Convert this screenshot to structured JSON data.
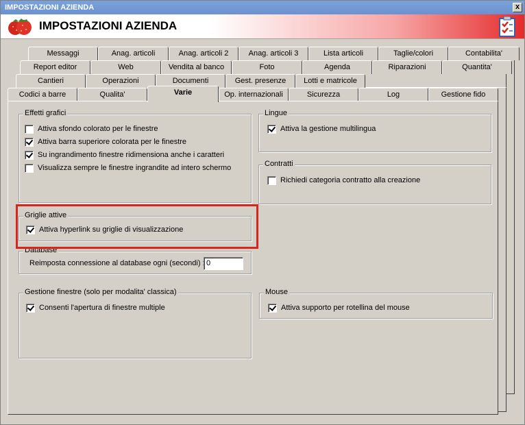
{
  "window": {
    "title": "IMPOSTAZIONI AZIENDA",
    "close_label": "x"
  },
  "header": {
    "title": "IMPOSTAZIONI AZIENDA",
    "logo_icon": "strawberries-icon",
    "right_icon": "checklist-icon"
  },
  "tabs": {
    "row1": [
      "Messaggi",
      "Anag. articoli",
      "Anag. articoli 2",
      "Anag. articoli 3",
      "Lista articoli",
      "Taglie/colori",
      "Contabilita'"
    ],
    "row2": [
      "Report editor",
      "Web",
      "Vendita al banco",
      "Foto",
      "Agenda",
      "Riparazioni",
      "Quantita'"
    ],
    "row3": [
      "Cantieri",
      "Operazioni",
      "Documenti",
      "Gest. presenze",
      "Lotti e matricole"
    ],
    "row4": [
      "Codici a barre",
      "Qualita'",
      "Varie",
      "Op. internazionali",
      "Sicurezza",
      "Log",
      "Gestione fido"
    ],
    "active": "Varie"
  },
  "effetti": {
    "label": "Effetti grafici",
    "items": [
      {
        "label": "Attiva sfondo colorato per le finestre",
        "checked": false
      },
      {
        "label": "Attiva barra superiore colorata per le finestre",
        "checked": true
      },
      {
        "label": "Su ingrandimento finestre ridimensiona anche i caratteri",
        "checked": true
      },
      {
        "label": "Visualizza sempre le finestre ingrandite ad intero schermo",
        "checked": false
      }
    ]
  },
  "griglie": {
    "label": "Griglie attive",
    "item": {
      "label": "Attiva hyperlink su griglie di visualizzazione",
      "checked": true
    }
  },
  "database": {
    "label": "Database",
    "field_label": "Reimposta connessione al database ogni (secondi) :",
    "value": "0"
  },
  "gestione": {
    "label": "Gestione finestre (solo per modalita' classica)",
    "item": {
      "label": "Consenti l'apertura di finestre multiple",
      "checked": true
    }
  },
  "lingue": {
    "label": "Lingue",
    "item": {
      "label": "Attiva la gestione multilingua",
      "checked": true
    }
  },
  "contratti": {
    "label": "Contratti",
    "item": {
      "label": "Richiedi categoria contratto alla creazione",
      "checked": false
    }
  },
  "mouse": {
    "label": "Mouse",
    "item": {
      "label": "Attiva supporto per rotellina del mouse",
      "checked": true
    }
  }
}
